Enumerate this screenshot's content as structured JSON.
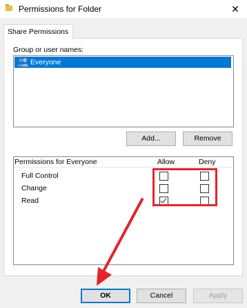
{
  "window": {
    "title": "Permissions for Folder",
    "close_glyph": "✕"
  },
  "tabs": [
    {
      "label": "Share Permissions",
      "active": true
    }
  ],
  "group_section": {
    "label": "Group or user names:",
    "users": [
      {
        "name": "Everyone",
        "selected": true,
        "icon": "users-icon"
      }
    ]
  },
  "buttons": {
    "add": "Add...",
    "remove": "Remove",
    "ok": "OK",
    "cancel": "Cancel",
    "apply": "Apply"
  },
  "permissions": {
    "header_label": "Permissions for Everyone",
    "allow_label": "Allow",
    "deny_label": "Deny",
    "rows": [
      {
        "name": "Full Control",
        "allow": false,
        "deny": false
      },
      {
        "name": "Change",
        "allow": false,
        "deny": false
      },
      {
        "name": "Read",
        "allow": true,
        "deny": false
      }
    ]
  },
  "annotation": {
    "highlight_color": "#e8222a",
    "arrow_color": "#e8222a"
  },
  "colors": {
    "selection": "#0078d7",
    "dialog_bg": "#f0f0f0"
  }
}
